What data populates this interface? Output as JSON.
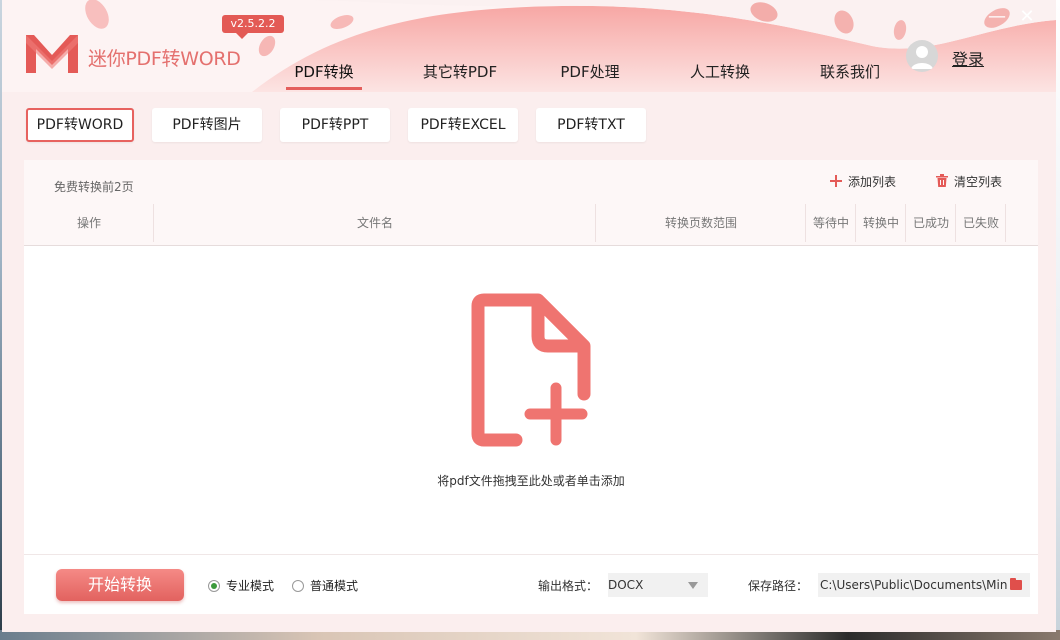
{
  "app": {
    "name": "迷你PDF转WORD",
    "version": "v2.5.2.2",
    "login_label": "登录",
    "close_glyph": "✕",
    "minimize_glyph": "—"
  },
  "nav": {
    "tabs": [
      {
        "label": "PDF转换",
        "active": true
      },
      {
        "label": "其它转PDF",
        "active": false
      },
      {
        "label": "PDF处理",
        "active": false
      },
      {
        "label": "人工转换",
        "active": false
      },
      {
        "label": "联系我们",
        "active": false
      }
    ]
  },
  "subtabs": [
    {
      "label": "PDF转WORD",
      "active": true
    },
    {
      "label": "PDF转图片",
      "active": false
    },
    {
      "label": "PDF转PPT",
      "active": false
    },
    {
      "label": "PDF转EXCEL",
      "active": false
    },
    {
      "label": "PDF转TXT",
      "active": false
    }
  ],
  "list": {
    "free_note": "免费转换前2页",
    "add_label": "添加列表",
    "clear_label": "清空列表",
    "columns": [
      "操作",
      "文件名",
      "转换页数范围",
      "等待中",
      "转换中",
      "已成功",
      "已失败"
    ]
  },
  "drop": {
    "hint": "将pdf文件拖拽至此处或者单击添加"
  },
  "footer": {
    "start_label": "开始转换",
    "modes": [
      {
        "label": "专业模式",
        "checked": true
      },
      {
        "label": "普通模式",
        "checked": false
      }
    ],
    "format_label": "输出格式：",
    "format_value": "DOCX",
    "path_label": "保存路径：",
    "path_value": "C:\\Users\\Public\\Documents\\MiniPDF"
  },
  "colors": {
    "accent": "#e4625f",
    "radio_checked": "#3c9a3c"
  },
  "icons": {
    "logo": "m-logo",
    "add": "plus-icon",
    "clear": "trash-icon",
    "drop": "file-add-icon",
    "folder": "folder-icon",
    "avatar": "user-avatar-icon"
  }
}
